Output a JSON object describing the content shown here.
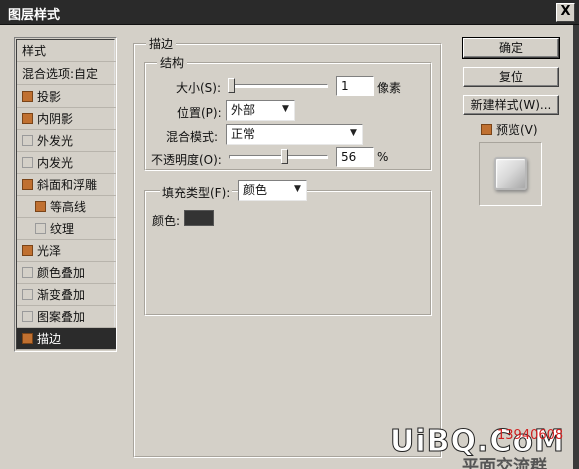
{
  "window": {
    "title": "图层样式",
    "close": "X"
  },
  "styles_list": {
    "header": "样式",
    "blend_options": "混合选项:自定",
    "items": [
      {
        "label": "投影",
        "checked": true
      },
      {
        "label": "内阴影",
        "checked": true
      },
      {
        "label": "外发光",
        "checked": false
      },
      {
        "label": "内发光",
        "checked": false
      },
      {
        "label": "斜面和浮雕",
        "checked": true
      },
      {
        "label": "等高线",
        "checked": true
      },
      {
        "label": "纹理",
        "checked": false
      },
      {
        "label": "光泽",
        "checked": true
      },
      {
        "label": "颜色叠加",
        "checked": false
      },
      {
        "label": "渐变叠加",
        "checked": false
      },
      {
        "label": "图案叠加",
        "checked": false
      },
      {
        "label": "描边",
        "checked": true,
        "selected": true
      }
    ]
  },
  "stroke": {
    "group_title": "描边",
    "structure": {
      "title": "结构",
      "size_label": "大小(S):",
      "size_value": "1",
      "size_unit": "像素",
      "position_label": "位置(P):",
      "position_value": "外部",
      "blend_mode_label": "混合模式:",
      "blend_mode_value": "正常",
      "opacity_label": "不透明度(O):",
      "opacity_value": "56",
      "opacity_unit": "%",
      "size_slider_fraction": 0.0,
      "opacity_slider_fraction": 0.56
    },
    "fill": {
      "fill_type_label": "填充类型(F):",
      "fill_type_value": "颜色",
      "color_label": "颜色:",
      "color": "#333333"
    }
  },
  "buttons": {
    "ok": "确定",
    "reset": "复位",
    "new_style": "新建样式(W)...",
    "preview_label": "预览(V)",
    "preview_checked": true
  },
  "overlay": {
    "brand": "UiBQ.CoM",
    "red_text": "13940608",
    "cn_text": "平面交流群"
  }
}
